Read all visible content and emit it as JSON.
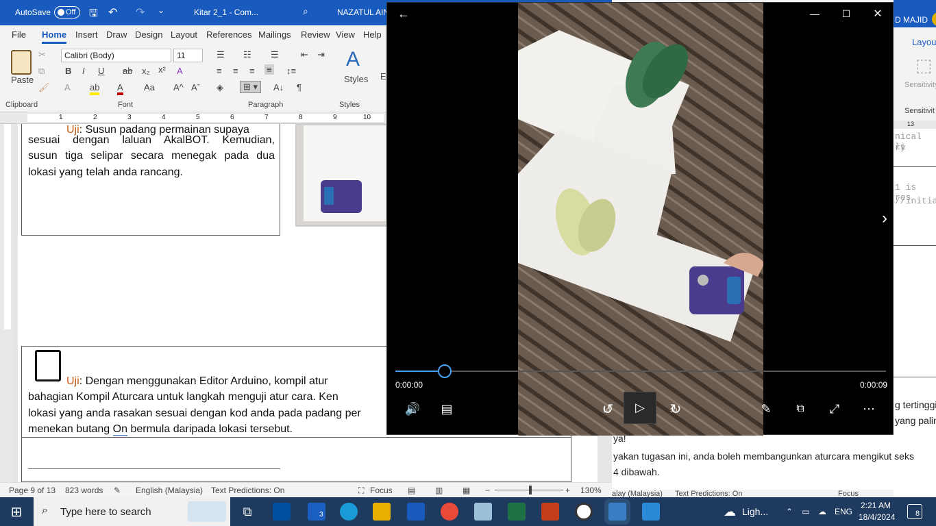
{
  "word": {
    "autosave_label": "AutoSave",
    "autosave_state": "Off",
    "doc_title": "Kitar 2_1 - Com...",
    "user": "NAZATUL AIN",
    "menu": [
      "File",
      "Home",
      "Insert",
      "Draw",
      "Design",
      "Layout",
      "References",
      "Mailings",
      "Review",
      "View",
      "Help"
    ],
    "font_name": "Calibri (Body)",
    "font_size": "11",
    "groups": {
      "clipboard": "Clipboard",
      "font": "Font",
      "paragraph": "Paragraph",
      "styles": "Styles"
    },
    "paste": "Paste",
    "styles": "Styles",
    "ruler_numbers": [
      "1",
      "2",
      "3",
      "4",
      "5",
      "6",
      "7",
      "8",
      "9",
      "10"
    ],
    "paragraph1": {
      "label": "Uji",
      "line0": ": Susun padang permainan supaya",
      "lines": [
        "sesuai dengan laluan AkalBOT. Kemudian,",
        "susun tiga selipar secara menegak pada dua",
        "lokasi yang telah anda rancang."
      ]
    },
    "paragraph2": {
      "label": "Uji",
      "line1": ": Dengan menggunakan Editor Arduino, kompil atur",
      "line2": "bahagian Kompil Aturcara untuk langkah menguji atur cara. Ken",
      "line3": "lokasi yang anda rasakan sesuai dengan kod anda pada padang per",
      "line4_a": "menekan butang ",
      "line4_b": "On",
      "line4_c": " bermula daripada lokasi tersebut."
    },
    "status": {
      "page": "Page 9 of 13",
      "words": "823 words",
      "language": "English (Malaysia)",
      "predictions": "Text Predictions: On",
      "focus": "Focus",
      "zoom": "130%"
    }
  },
  "behind_window": {
    "user": "D MAJID",
    "tab": "Layout",
    "sensitivity": "Sensitivity",
    "sensitivity_group": "Sensitivit",
    "ruler": "13",
    "code1": "nical li",
    "code2": "ry",
    "code3": "1 is res",
    "code4": "//initia",
    "text1": "g tertinggi",
    "text2": "yang palin",
    "text3": "ya!",
    "text4": "yakan tugasan ini, anda boleh membangunkan aturcara mengikut seks",
    "text5": "4 dibawah.",
    "status_lang": "alay (Malaysia)",
    "status_pred": "Text Predictions: On",
    "status_focus": "Focus"
  },
  "player": {
    "current_time": "0:00:00",
    "total_time": "0:00:09",
    "progress_fraction": 0.1,
    "skip_back": "10",
    "skip_forward": "30"
  },
  "taskbar": {
    "search_placeholder": "Type here to search",
    "badge": "3",
    "weather": "Ligh...",
    "lang": "ENG",
    "time": "2:21 AM",
    "date": "18/4/2024",
    "notifications": "8"
  },
  "colors": {
    "word_blue": "#185abd",
    "accent_orange": "#c55a11",
    "player_blue": "#4aa3f0"
  }
}
